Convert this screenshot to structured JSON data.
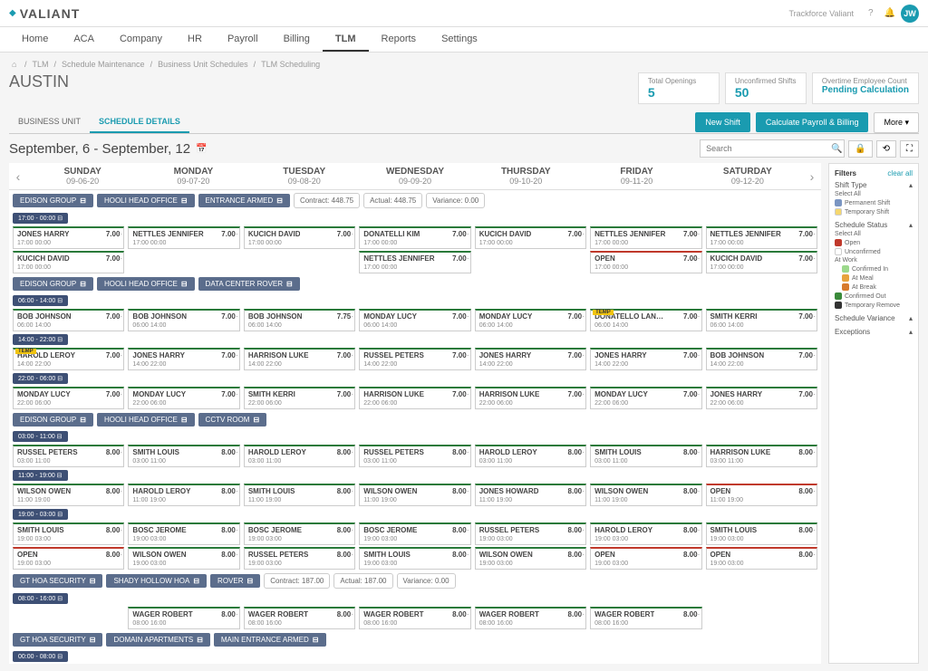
{
  "header": {
    "logo": "VALIANT",
    "account": "Trackforce Valiant",
    "userInitials": "JW"
  },
  "nav": [
    "Home",
    "ACA",
    "Company",
    "HR",
    "Payroll",
    "Billing",
    "TLM",
    "Reports",
    "Settings"
  ],
  "navActive": "TLM",
  "breadcrumb": [
    "TLM",
    "Schedule Maintenance",
    "Business Unit Schedules",
    "TLM Scheduling"
  ],
  "pageTitle": "AUSTIN",
  "summary": [
    {
      "label": "Total Openings",
      "value": "5"
    },
    {
      "label": "Unconfirmed Shifts",
      "value": "50"
    },
    {
      "label": "Overtime Employee Count",
      "value": "Pending Calculation",
      "pending": true
    }
  ],
  "subTabs": [
    "BUSINESS UNIT",
    "SCHEDULE DETAILS"
  ],
  "subTabActive": "SCHEDULE DETAILS",
  "actions": {
    "newShift": "New Shift",
    "calcPayroll": "Calculate Payroll & Billing",
    "more": "More"
  },
  "dateRange": "September, 6 - September, 12",
  "searchPlaceholder": "Search",
  "days": [
    {
      "name": "SUNDAY",
      "date": "09-06-20"
    },
    {
      "name": "MONDAY",
      "date": "09-07-20"
    },
    {
      "name": "TUESDAY",
      "date": "09-08-20"
    },
    {
      "name": "WEDNESDAY",
      "date": "09-09-20"
    },
    {
      "name": "THURSDAY",
      "date": "09-10-20"
    },
    {
      "name": "FRIDAY",
      "date": "09-11-20"
    },
    {
      "name": "SATURDAY",
      "date": "09-12-20"
    }
  ],
  "groups": [
    {
      "tags": [
        "EDISON GROUP",
        "HOOLI HEAD OFFICE",
        "ENTRANCE ARMED"
      ],
      "stats": [
        {
          "label": "Contract:",
          "value": "448.75"
        },
        {
          "label": "Actual:",
          "value": "448.75"
        },
        {
          "label": "Variance:",
          "value": "0.00"
        }
      ],
      "timePill": "17:00 - 00:00",
      "rows": [
        [
          {
            "name": "JONES HARRY",
            "hours": "7.00",
            "time": "17:00   00:00"
          },
          {
            "name": "NETTLES JENNIFER",
            "hours": "7.00",
            "time": "17:00   00:00"
          },
          {
            "name": "KUCICH DAVID",
            "hours": "7.00",
            "time": "17:00   00:00"
          },
          {
            "name": "DONATELLI KIM",
            "hours": "7.00",
            "time": "17:00   00:00"
          },
          {
            "name": "KUCICH DAVID",
            "hours": "7.00",
            "time": "17:00   00:00"
          },
          {
            "name": "NETTLES JENNIFER",
            "hours": "7.00",
            "time": "17:00   00:00"
          },
          {
            "name": "NETTLES JENNIFER",
            "hours": "7.00",
            "time": "17:00   00:00"
          }
        ],
        [
          {
            "name": "KUCICH DAVID",
            "hours": "7.00",
            "time": "17:00   00:00"
          },
          null,
          null,
          {
            "name": "NETTLES JENNIFER",
            "hours": "7.00",
            "time": "17:00   00:00"
          },
          null,
          {
            "name": "OPEN",
            "hours": "7.00",
            "time": "17:00   00:00",
            "open": true
          },
          {
            "name": "KUCICH DAVID",
            "hours": "7.00",
            "time": "17:00   00:00"
          }
        ]
      ]
    },
    {
      "tags": [
        "EDISON GROUP",
        "HOOLI HEAD OFFICE",
        "DATA CENTER ROVER"
      ],
      "timePill": "06:00 - 14:00",
      "rows": [
        [
          {
            "name": "BOB JOHNSON",
            "hours": "7.00",
            "time": "06:00   14:00"
          },
          {
            "name": "BOB JOHNSON",
            "hours": "7.00",
            "time": "06:00   14:00"
          },
          {
            "name": "BOB JOHNSON",
            "hours": "7.75",
            "time": "06:00   14:00"
          },
          {
            "name": "MONDAY LUCY",
            "hours": "7.00",
            "time": "06:00   14:00"
          },
          {
            "name": "MONDAY LUCY",
            "hours": "7.00",
            "time": "06:00   14:00"
          },
          {
            "name": "DONATELLO LANESTER",
            "hours": "7.00",
            "time": "06:00   14:00",
            "temp": true
          },
          {
            "name": "SMITH KERRI",
            "hours": "7.00",
            "time": "06:00   14:00"
          }
        ]
      ],
      "timePill2": "14:00 - 22:00",
      "rows2": [
        [
          {
            "name": "HAROLD LEROY",
            "hours": "7.00",
            "time": "14:00   22:00",
            "temp": true
          },
          {
            "name": "JONES HARRY",
            "hours": "7.00",
            "time": "14:00   22:00"
          },
          {
            "name": "HARRISON LUKE",
            "hours": "7.00",
            "time": "14:00   22:00"
          },
          {
            "name": "RUSSEL PETERS",
            "hours": "7.00",
            "time": "14:00   22:00"
          },
          {
            "name": "JONES HARRY",
            "hours": "7.00",
            "time": "14:00   22:00"
          },
          {
            "name": "JONES HARRY",
            "hours": "7.00",
            "time": "14:00   22:00"
          },
          {
            "name": "BOB JOHNSON",
            "hours": "7.00",
            "time": "14:00   22:00"
          }
        ]
      ],
      "timePill3": "22:00 - 06:00",
      "rows3": [
        [
          {
            "name": "MONDAY LUCY",
            "hours": "7.00",
            "time": "22:00   06:00"
          },
          {
            "name": "MONDAY LUCY",
            "hours": "7.00",
            "time": "22:00   06:00"
          },
          {
            "name": "SMITH KERRI",
            "hours": "7.00",
            "time": "22:00   06:00"
          },
          {
            "name": "HARRISON LUKE",
            "hours": "7.00",
            "time": "22:00   06:00"
          },
          {
            "name": "HARRISON LUKE",
            "hours": "7.00",
            "time": "22:00   06:00"
          },
          {
            "name": "MONDAY LUCY",
            "hours": "7.00",
            "time": "22:00   06:00"
          },
          {
            "name": "JONES HARRY",
            "hours": "7.00",
            "time": "22:00   06:00"
          }
        ]
      ]
    },
    {
      "tags": [
        "EDISON GROUP",
        "HOOLI HEAD OFFICE",
        "CCTV ROOM"
      ],
      "timePill": "03:00 - 11:00",
      "rows": [
        [
          {
            "name": "RUSSEL PETERS",
            "hours": "8.00",
            "time": "03:00   11:00"
          },
          {
            "name": "SMITH LOUIS",
            "hours": "8.00",
            "time": "03:00   11:00"
          },
          {
            "name": "HAROLD LEROY",
            "hours": "8.00",
            "time": "03:00   11:00"
          },
          {
            "name": "RUSSEL PETERS",
            "hours": "8.00",
            "time": "03:00   11:00"
          },
          {
            "name": "HAROLD LEROY",
            "hours": "8.00",
            "time": "03:00   11:00"
          },
          {
            "name": "SMITH LOUIS",
            "hours": "8.00",
            "time": "03:00   11:00"
          },
          {
            "name": "HARRISON LUKE",
            "hours": "8.00",
            "time": "03:00   11:00"
          }
        ]
      ],
      "timePill2": "11:00 - 19:00",
      "rows2": [
        [
          {
            "name": "WILSON OWEN",
            "hours": "8.00",
            "time": "11:00   19:00"
          },
          {
            "name": "HAROLD LEROY",
            "hours": "8.00",
            "time": "11:00   19:00"
          },
          {
            "name": "SMITH LOUIS",
            "hours": "8.00",
            "time": "11:00   19:00"
          },
          {
            "name": "WILSON OWEN",
            "hours": "8.00",
            "time": "11:00   19:00"
          },
          {
            "name": "JONES HOWARD",
            "hours": "8.00",
            "time": "11:00   19:00"
          },
          {
            "name": "WILSON OWEN",
            "hours": "8.00",
            "time": "11:00   19:00"
          },
          {
            "name": "OPEN",
            "hours": "8.00",
            "time": "11:00   19:00",
            "open": true
          }
        ]
      ],
      "timePill3": "19:00 - 03:00",
      "rows3": [
        [
          {
            "name": "SMITH LOUIS",
            "hours": "8.00",
            "time": "19:00   03:00"
          },
          {
            "name": "BOSC JEROME",
            "hours": "8.00",
            "time": "19:00   03:00"
          },
          {
            "name": "BOSC JEROME",
            "hours": "8.00",
            "time": "19:00   03:00"
          },
          {
            "name": "BOSC JEROME",
            "hours": "8.00",
            "time": "19:00   03:00"
          },
          {
            "name": "RUSSEL PETERS",
            "hours": "8.00",
            "time": "19:00   03:00"
          },
          {
            "name": "HAROLD LEROY",
            "hours": "8.00",
            "time": "19:00   03:00"
          },
          {
            "name": "SMITH LOUIS",
            "hours": "8.00",
            "time": "19:00   03:00"
          }
        ],
        [
          {
            "name": "OPEN",
            "hours": "8.00",
            "time": "19:00   03:00",
            "open": true
          },
          {
            "name": "WILSON OWEN",
            "hours": "8.00",
            "time": "19:00   03:00"
          },
          {
            "name": "RUSSEL PETERS",
            "hours": "8.00",
            "time": "19:00   03:00"
          },
          {
            "name": "SMITH LOUIS",
            "hours": "8.00",
            "time": "19:00   03:00"
          },
          {
            "name": "WILSON OWEN",
            "hours": "8.00",
            "time": "19:00   03:00"
          },
          {
            "name": "OPEN",
            "hours": "8.00",
            "time": "19:00   03:00",
            "open": true
          },
          {
            "name": "OPEN",
            "hours": "8.00",
            "time": "19:00   03:00",
            "open": true
          }
        ]
      ]
    },
    {
      "tags": [
        "GT HOA SECURITY",
        "SHADY HOLLOW HOA",
        "ROVER"
      ],
      "stats": [
        {
          "label": "Contract:",
          "value": "187.00"
        },
        {
          "label": "Actual:",
          "value": "187.00"
        },
        {
          "label": "Variance:",
          "value": "0.00"
        }
      ],
      "timePill": "08:00 - 16:00",
      "rows": [
        [
          null,
          {
            "name": "WAGER ROBERT",
            "hours": "8.00",
            "time": "08:00   16:00"
          },
          {
            "name": "WAGER ROBERT",
            "hours": "8.00",
            "time": "08:00   16:00"
          },
          {
            "name": "WAGER ROBERT",
            "hours": "8.00",
            "time": "08:00   16:00"
          },
          {
            "name": "WAGER ROBERT",
            "hours": "8.00",
            "time": "08:00   16:00"
          },
          {
            "name": "WAGER ROBERT",
            "hours": "8.00",
            "time": "08:00   16:00"
          },
          null
        ]
      ]
    },
    {
      "tags": [
        "GT HOA SECURITY",
        "DOMAIN APARTMENTS",
        "MAIN ENTRANCE ARMED"
      ],
      "timePill": "00:00 - 08:00",
      "rows": []
    }
  ],
  "filters": {
    "title": "Filters",
    "clearAll": "clear all",
    "sections": [
      {
        "title": "Shift Type",
        "selectAll": "Select All",
        "items": [
          {
            "label": "Permanent Shift",
            "swatch": "sw-blue"
          },
          {
            "label": "Temporary Shift",
            "swatch": "sw-yellow"
          }
        ]
      },
      {
        "title": "Schedule Status",
        "selectAll": "Select All",
        "items": [
          {
            "label": "Open",
            "swatch": "sw-red"
          },
          {
            "label": "Unconfirmed",
            "swatch": "sw-white"
          },
          {
            "label": "At Work",
            "swatch": null
          },
          {
            "label": "Confirmed In",
            "swatch": "sw-ltgreen",
            "indent": true
          },
          {
            "label": "At Meal",
            "swatch": "sw-orange",
            "indent": true
          },
          {
            "label": "At Break",
            "swatch": "sw-dkorange",
            "indent": true
          },
          {
            "label": "Confirmed Out",
            "swatch": "sw-green"
          },
          {
            "label": "Temporary Remove",
            "swatch": "sw-black"
          }
        ]
      },
      {
        "title": "Schedule Variance",
        "collapsed": true
      },
      {
        "title": "Exceptions",
        "collapsed": true
      }
    ]
  }
}
